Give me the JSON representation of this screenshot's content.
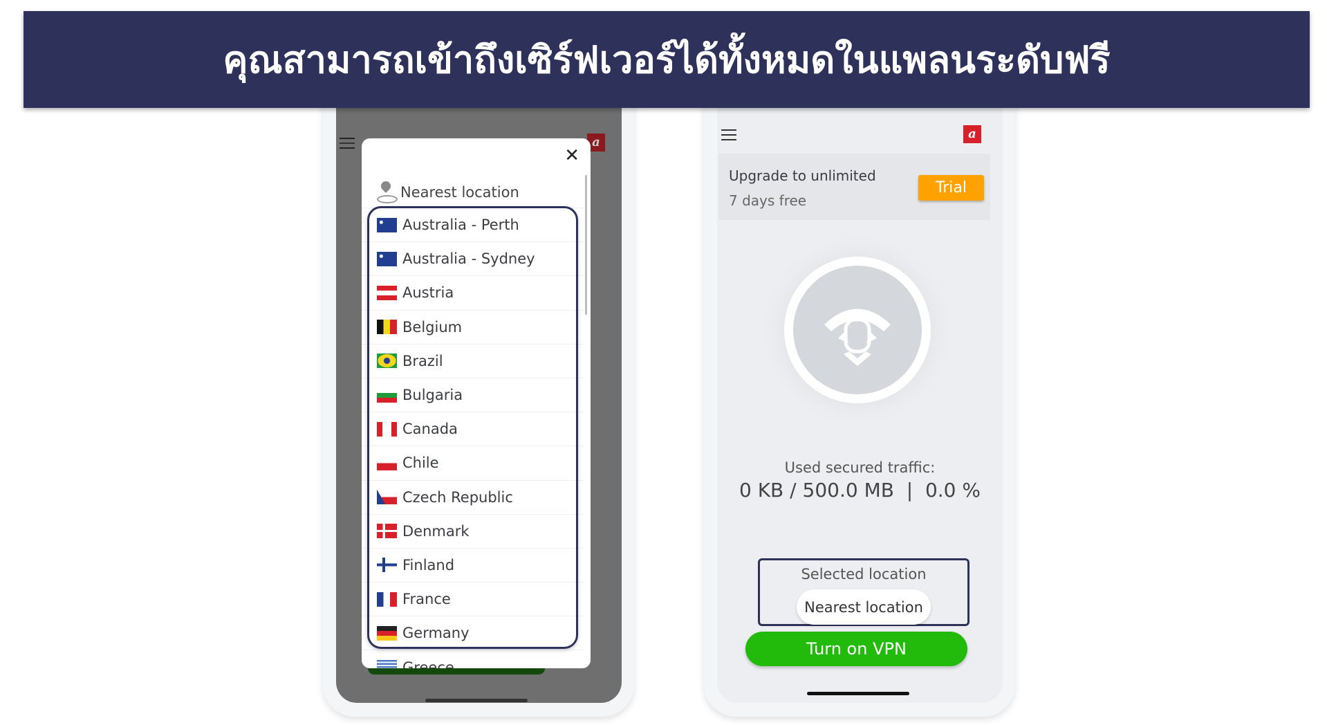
{
  "banner": {
    "title": "คุณสามารถเข้าถึงเซิร์ฟเวอร์ได้ทั้งหมดในแพลนระดับฟรี"
  },
  "left_phone": {
    "modal": {
      "close_icon": "close-icon",
      "nearest_label": "Nearest location",
      "locations": [
        {
          "label": "Australia - Perth",
          "flag": "au"
        },
        {
          "label": "Australia - Sydney",
          "flag": "au"
        },
        {
          "label": "Austria",
          "flag": "at"
        },
        {
          "label": "Belgium",
          "flag": "be"
        },
        {
          "label": "Brazil",
          "flag": "br"
        },
        {
          "label": "Bulgaria",
          "flag": "bg"
        },
        {
          "label": "Canada",
          "flag": "ca"
        },
        {
          "label": "Chile",
          "flag": "cl"
        },
        {
          "label": "Czech Republic",
          "flag": "cz"
        },
        {
          "label": "Denmark",
          "flag": "dk"
        },
        {
          "label": "Finland",
          "flag": "fi"
        },
        {
          "label": "France",
          "flag": "fr"
        },
        {
          "label": "Germany",
          "flag": "de"
        },
        {
          "label": "Greece",
          "flag": "gr"
        }
      ]
    }
  },
  "right_phone": {
    "upgrade_title": "Upgrade to unlimited",
    "upgrade_sub": "7 days free",
    "trial_label": "Trial",
    "used_label": "Used secured traffic:",
    "traffic_value": "0 KB / 500.0 MB  |  0.0 %",
    "selected_label": "Selected location",
    "selected_value": "Nearest location",
    "vpn_button": "Turn on VPN"
  },
  "colors": {
    "banner": "#2e3159",
    "trial": "#ffa200",
    "vpn": "#22bb0b",
    "brand": "#d8202a"
  }
}
